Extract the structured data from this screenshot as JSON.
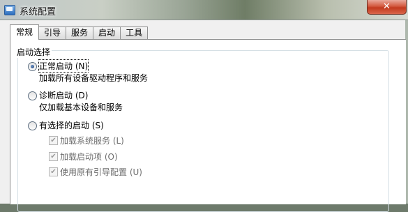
{
  "window": {
    "title": "系统配置",
    "close_glyph": "✕"
  },
  "tabs": [
    "常规",
    "引导",
    "服务",
    "启动",
    "工具"
  ],
  "startup_selection": {
    "group_title": "启动选择",
    "options": [
      {
        "label": "正常启动 (N)",
        "description": "加载所有设备驱动程序和服务",
        "checked": true
      },
      {
        "label": "诊断启动 (D)",
        "description": "仅加载基本设备和服务",
        "checked": false
      },
      {
        "label": "有选择的启动 (S)",
        "checked": false
      }
    ],
    "selective_items": [
      {
        "label": "加载系统服务 (L)",
        "checked": true,
        "enabled": false
      },
      {
        "label": "加载启动项 (O)",
        "checked": true,
        "enabled": false
      },
      {
        "label": "使用原有引导配置 (U)",
        "checked": true,
        "enabled": false
      }
    ]
  },
  "colors": {
    "close_button": "#c8452a",
    "panel_background": "#ffffff",
    "disabled_text": "#6d6d6d"
  }
}
